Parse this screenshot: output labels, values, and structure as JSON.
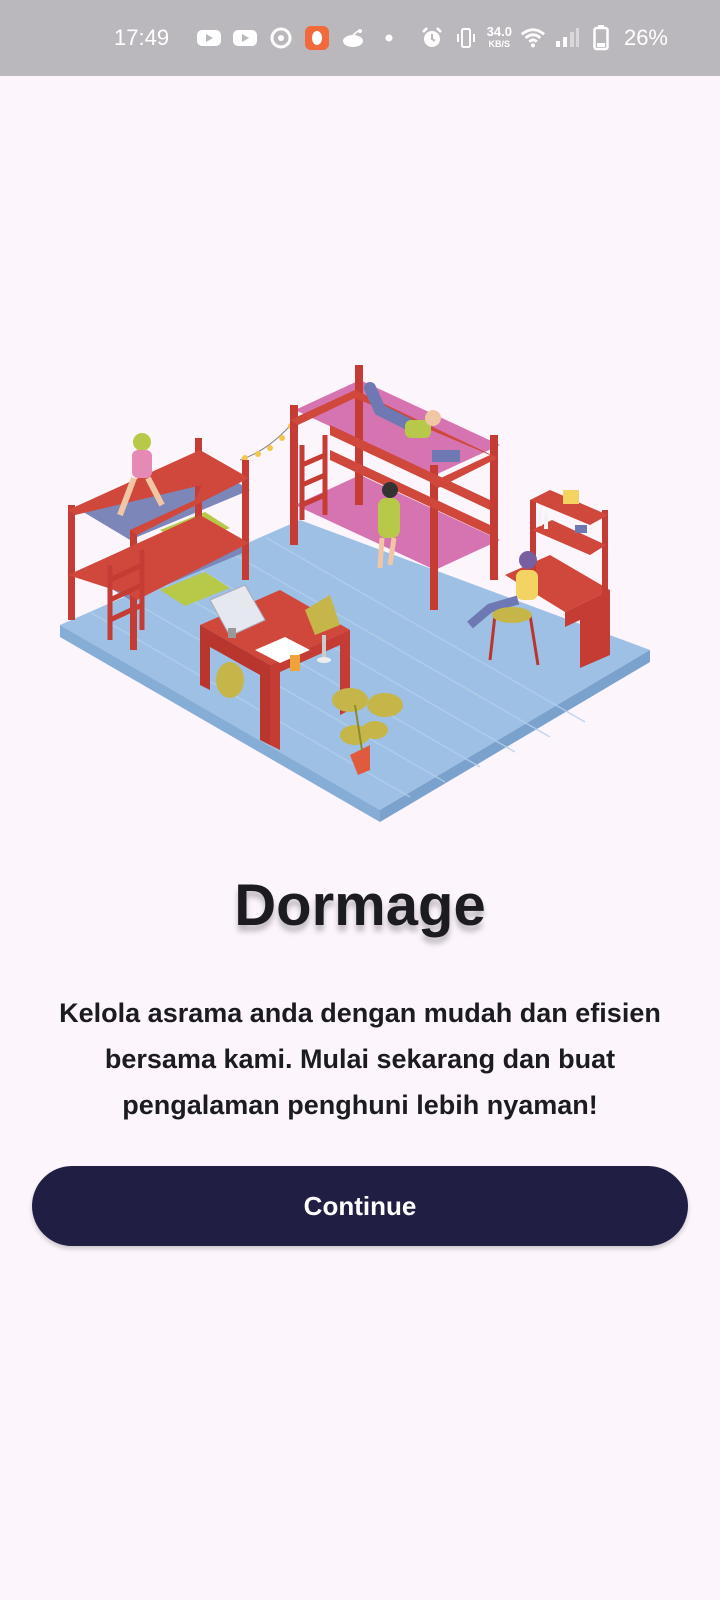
{
  "status_bar": {
    "time": "17:49",
    "left_icons": [
      "youtube-icon",
      "youtube-icon",
      "circle-app-icon",
      "orange-app-icon",
      "reddit-icon",
      "dot-icon"
    ],
    "net_speed_value": "34.0",
    "net_speed_unit": "KB/S",
    "battery_percent": "26%"
  },
  "onboarding": {
    "title": "Dormage",
    "description": "Kelola asrama anda dengan mudah dan efisien bersama kami. Mulai sekarang dan buat pengalaman penghuni lebih nyaman!",
    "continue_label": "Continue"
  },
  "colors": {
    "background": "#fcf5fc",
    "status_bar": "#bbb8bd",
    "button": "#211e44",
    "title": "#1c1b22"
  }
}
